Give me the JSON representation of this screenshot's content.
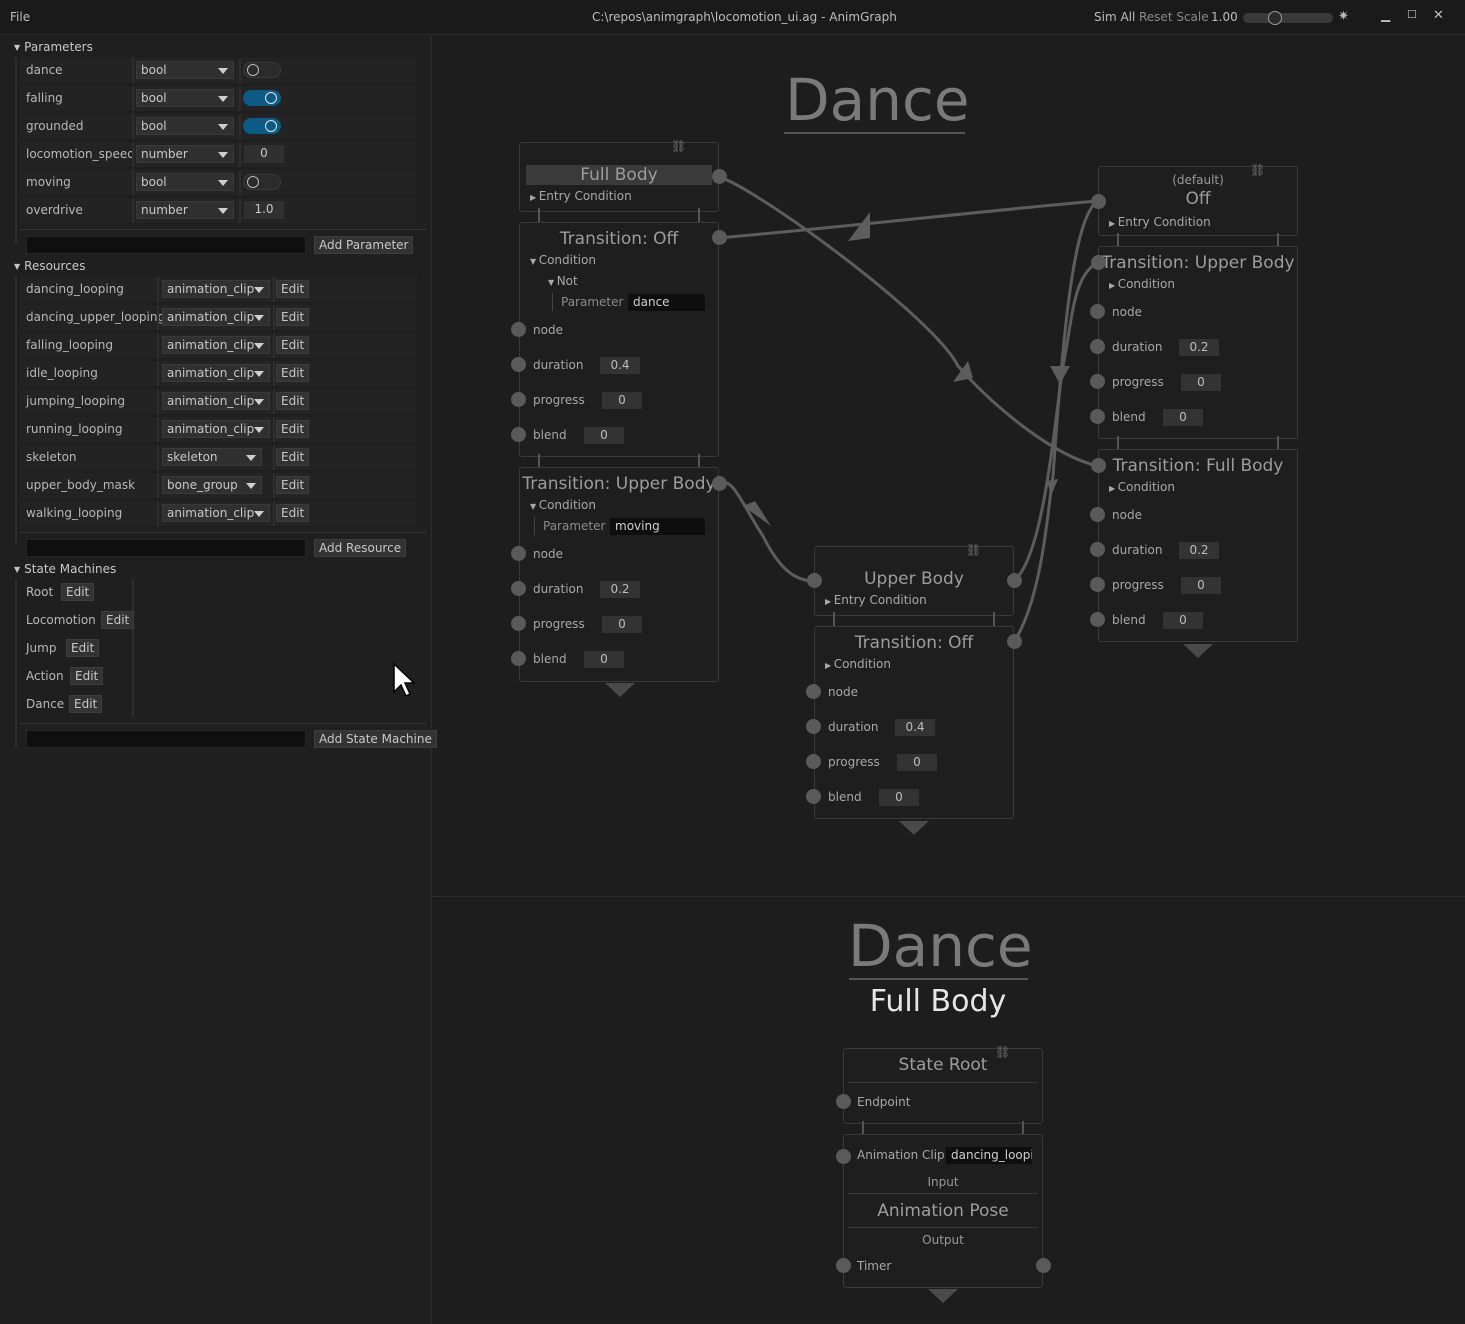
{
  "titlebar": {
    "menu_file": "File",
    "title": "C:\\repos\\animgraph\\locomotion_ui.ag - AnimGraph",
    "sim_all": "Sim All",
    "reset_scale": "Reset Scale",
    "scale_value": "1.00",
    "scale_fraction": 0.33
  },
  "sidebar": {
    "parameters_title": "Parameters",
    "parameters": [
      {
        "name": "dance",
        "type": "bool",
        "value": false
      },
      {
        "name": "falling",
        "type": "bool",
        "value": true
      },
      {
        "name": "grounded",
        "type": "bool",
        "value": true
      },
      {
        "name": "locomotion_speed",
        "type": "number",
        "value": "0"
      },
      {
        "name": "moving",
        "type": "bool",
        "value": false
      },
      {
        "name": "overdrive",
        "type": "number",
        "value": "1.0"
      }
    ],
    "add_parameter": "Add Parameter",
    "resources_title": "Resources",
    "resources": [
      {
        "name": "dancing_looping",
        "type": "animation_clip",
        "edit": "Edit"
      },
      {
        "name": "dancing_upper_looping",
        "type": "animation_clip",
        "edit": "Edit"
      },
      {
        "name": "falling_looping",
        "type": "animation_clip",
        "edit": "Edit"
      },
      {
        "name": "idle_looping",
        "type": "animation_clip",
        "edit": "Edit"
      },
      {
        "name": "jumping_looping",
        "type": "animation_clip",
        "edit": "Edit"
      },
      {
        "name": "running_looping",
        "type": "animation_clip",
        "edit": "Edit"
      },
      {
        "name": "skeleton",
        "type": "skeleton",
        "edit": "Edit"
      },
      {
        "name": "upper_body_mask",
        "type": "bone_group",
        "edit": "Edit"
      },
      {
        "name": "walking_looping",
        "type": "animation_clip",
        "edit": "Edit"
      }
    ],
    "add_resource": "Add Resource",
    "state_machines_title": "State Machines",
    "state_machines": [
      {
        "name": "Root",
        "edit": "Edit"
      },
      {
        "name": "Locomotion",
        "edit": "Edit"
      },
      {
        "name": "Jump",
        "edit": "Edit"
      },
      {
        "name": "Action",
        "edit": "Edit"
      },
      {
        "name": "Dance",
        "edit": "Edit"
      }
    ],
    "add_state_machine": "Add State Machine"
  },
  "graph": {
    "title": "Dance",
    "full_body": {
      "title": "Full Body",
      "entry_condition": "Entry Condition",
      "transition_off": {
        "title": "Transition: Off",
        "condition": "Condition",
        "not": "Not",
        "parameter_label": "Parameter",
        "parameter": "dance",
        "node": "node",
        "duration_label": "duration",
        "duration": "0.4",
        "progress_label": "progress",
        "progress": "0",
        "blend_label": "blend",
        "blend": "0"
      },
      "transition_upper": {
        "title": "Transition: Upper Body",
        "condition": "Condition",
        "parameter_label": "Parameter",
        "parameter": "moving",
        "node": "node",
        "duration_label": "duration",
        "duration": "0.2",
        "progress_label": "progress",
        "progress": "0",
        "blend_label": "blend",
        "blend": "0"
      }
    },
    "upper_body": {
      "title": "Upper Body",
      "entry_condition": "Entry Condition",
      "transition_off": {
        "title": "Transition: Off",
        "condition": "Condition",
        "node": "node",
        "duration_label": "duration",
        "duration": "0.4",
        "progress_label": "progress",
        "progress": "0",
        "blend_label": "blend",
        "blend": "0"
      }
    },
    "off": {
      "default_label": "(default)",
      "title": "Off",
      "entry_condition": "Entry Condition",
      "transition_upper": {
        "title": "Transition: Upper Body",
        "condition": "Condition",
        "node": "node",
        "duration_label": "duration",
        "duration": "0.2",
        "progress_label": "progress",
        "progress": "0",
        "blend_label": "blend",
        "blend": "0"
      },
      "transition_full": {
        "title": "Transition: Full Body",
        "condition": "Condition",
        "node": "node",
        "duration_label": "duration",
        "duration": "0.2",
        "progress_label": "progress",
        "progress": "0",
        "blend_label": "blend",
        "blend": "0"
      }
    }
  },
  "lower": {
    "title": "Dance",
    "subtitle": "Full Body",
    "state_root": {
      "title": "State Root",
      "endpoint": "Endpoint"
    },
    "anim_pose": {
      "clip_label": "Animation Clip",
      "clip_value": "dancing_loopi",
      "input": "Input",
      "title": "Animation Pose",
      "output": "Output",
      "timer": "Timer"
    }
  }
}
